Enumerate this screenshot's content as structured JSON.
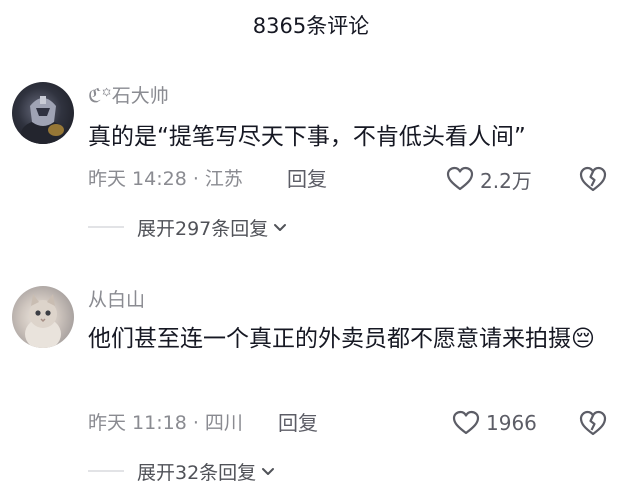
{
  "header": {
    "title": "8365条评论"
  },
  "comments": [
    {
      "username": "ℭ꙳石大帅",
      "text": "真的是“提笔写尽天下事，不肯低头看人间”",
      "time_location": "昨天 14:28 · 江苏",
      "reply_label": "回复",
      "likes": "2.2万",
      "expand_label": "展开297条回复"
    },
    {
      "username": "从白山",
      "text": "他们甚至连一个真正的外卖员都不愿意请来拍摄😔",
      "time_location": "昨天 11:18 · 四川",
      "reply_label": "回复",
      "likes": "1966",
      "expand_label": "展开32条回复"
    }
  ],
  "icons": {
    "like": "heart-outline-icon",
    "dislike": "broken-heart-icon",
    "expand": "chevron-down-icon"
  },
  "colors": {
    "text": "#161823",
    "secondary": "#8a8b91",
    "icon": "#5c5d66"
  }
}
